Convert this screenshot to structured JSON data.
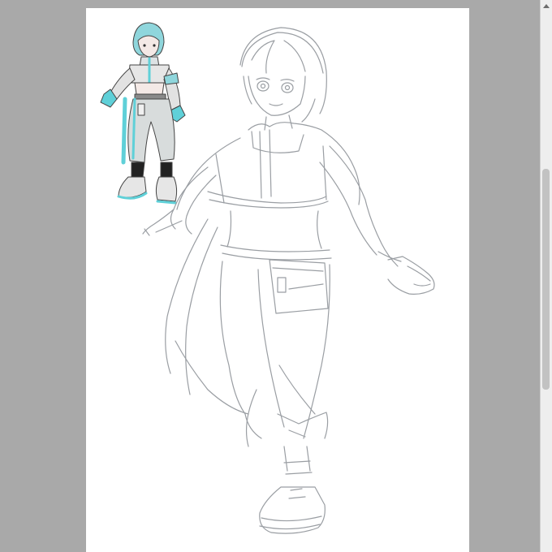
{
  "app": {
    "canvas_background": "#ffffff",
    "workspace_background": "#a9a9a9"
  },
  "scrollbar": {
    "up_icon": "chevron-up-icon",
    "thumb_color": "#c2c2c2"
  },
  "artwork": {
    "reference_accent": "#5fd0d8",
    "sketch_stroke": "#9a9ea3"
  }
}
